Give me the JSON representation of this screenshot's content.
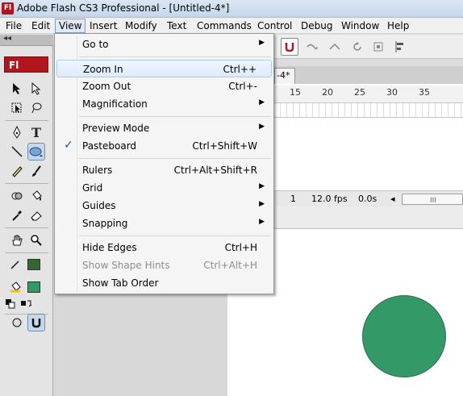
{
  "window": {
    "app_icon_text": "Fl",
    "title": "Adobe Flash CS3 Professional - [Untitled-4*]"
  },
  "menubar": {
    "items": [
      {
        "label": "File"
      },
      {
        "label": "Edit"
      },
      {
        "label": "View"
      },
      {
        "label": "Insert"
      },
      {
        "label": "Modify"
      },
      {
        "label": "Text"
      },
      {
        "label": "Commands"
      },
      {
        "label": "Control"
      },
      {
        "label": "Debug"
      },
      {
        "label": "Window"
      },
      {
        "label": "Help"
      }
    ],
    "open_menu": "View"
  },
  "toolbox": {
    "collapse_glyph": "◂◂",
    "tab_label": "Fl",
    "stroke_color": "#336633",
    "fill_color": "#339966"
  },
  "view_menu": {
    "items": [
      {
        "label": "Go to",
        "shortcut": "",
        "submenu": true
      },
      {
        "label": "Zoom In",
        "shortcut": "Ctrl++",
        "highlighted": true
      },
      {
        "label": "Zoom Out",
        "shortcut": "Ctrl+-"
      },
      {
        "label": "Magnification",
        "shortcut": "",
        "submenu": true
      },
      {
        "label": "Preview Mode",
        "shortcut": "",
        "submenu": true
      },
      {
        "label": "Pasteboard",
        "shortcut": "Ctrl+Shift+W",
        "checked": true
      },
      {
        "label": "Rulers",
        "shortcut": "Ctrl+Alt+Shift+R"
      },
      {
        "label": "Grid",
        "shortcut": "",
        "submenu": true
      },
      {
        "label": "Guides",
        "shortcut": "",
        "submenu": true
      },
      {
        "label": "Snapping",
        "shortcut": "",
        "submenu": true
      },
      {
        "label": "Hide Edges",
        "shortcut": "Ctrl+H"
      },
      {
        "label": "Show Shape Hints",
        "shortcut": "Ctrl+Alt+H",
        "disabled": true
      },
      {
        "label": "Show Tab Order",
        "shortcut": ""
      }
    ],
    "checkmark": "✓",
    "submenu_arrow": "▶"
  },
  "document": {
    "tab_label": "-4*"
  },
  "timeline": {
    "ruler_numbers": [
      "15",
      "20",
      "25",
      "30",
      "35"
    ],
    "current_frame": "1",
    "frame_rate": "12.0 fps",
    "elapsed_time": "0.0s",
    "scroll_left_glyph": "◂",
    "scroll_thumb_glyph": "III"
  },
  "stage": {
    "shape_color": "#339966"
  }
}
